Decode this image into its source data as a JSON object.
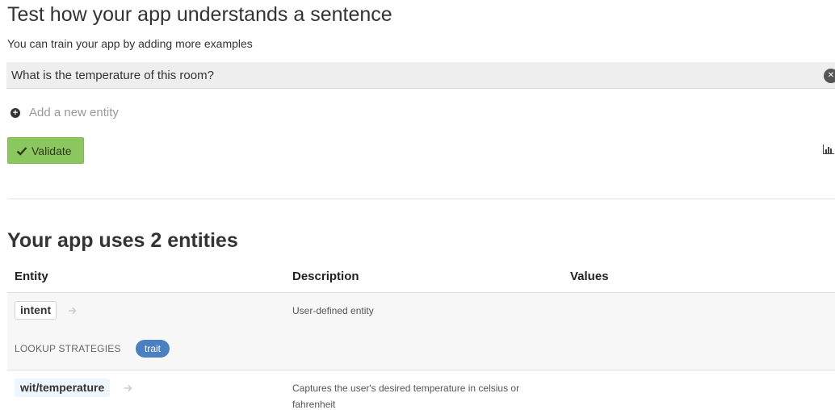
{
  "test_section": {
    "title": "Test how your app understands a sentence",
    "subtitle": "You can train your app by adding more examples",
    "sentence_value": "What is the temperature of this room?",
    "add_entity_label": "Add a new entity",
    "validate_label": "Validate"
  },
  "entities_section": {
    "title": "Your app uses 2 entities",
    "columns": [
      "Entity",
      "Description",
      "Values"
    ],
    "rows": [
      {
        "entity": "intent",
        "description": "User-defined entity",
        "lookup_label": "LOOKUP STRATEGIES",
        "lookup_badge": "trait"
      },
      {
        "entity": "wit/temperature",
        "description": "Captures the user's desired temperature in celsius or fahrenheit"
      }
    ]
  },
  "icons": {
    "clear": "close-circle-icon",
    "add": "plus-circle-icon",
    "validate": "check-icon",
    "stats": "bar-chart-icon",
    "row_arrow": "arrow-right-icon"
  },
  "colors": {
    "validate_bg": "#8cc65e",
    "badge_bg": "#4a7fc1",
    "input_bg": "#eeeeee"
  }
}
